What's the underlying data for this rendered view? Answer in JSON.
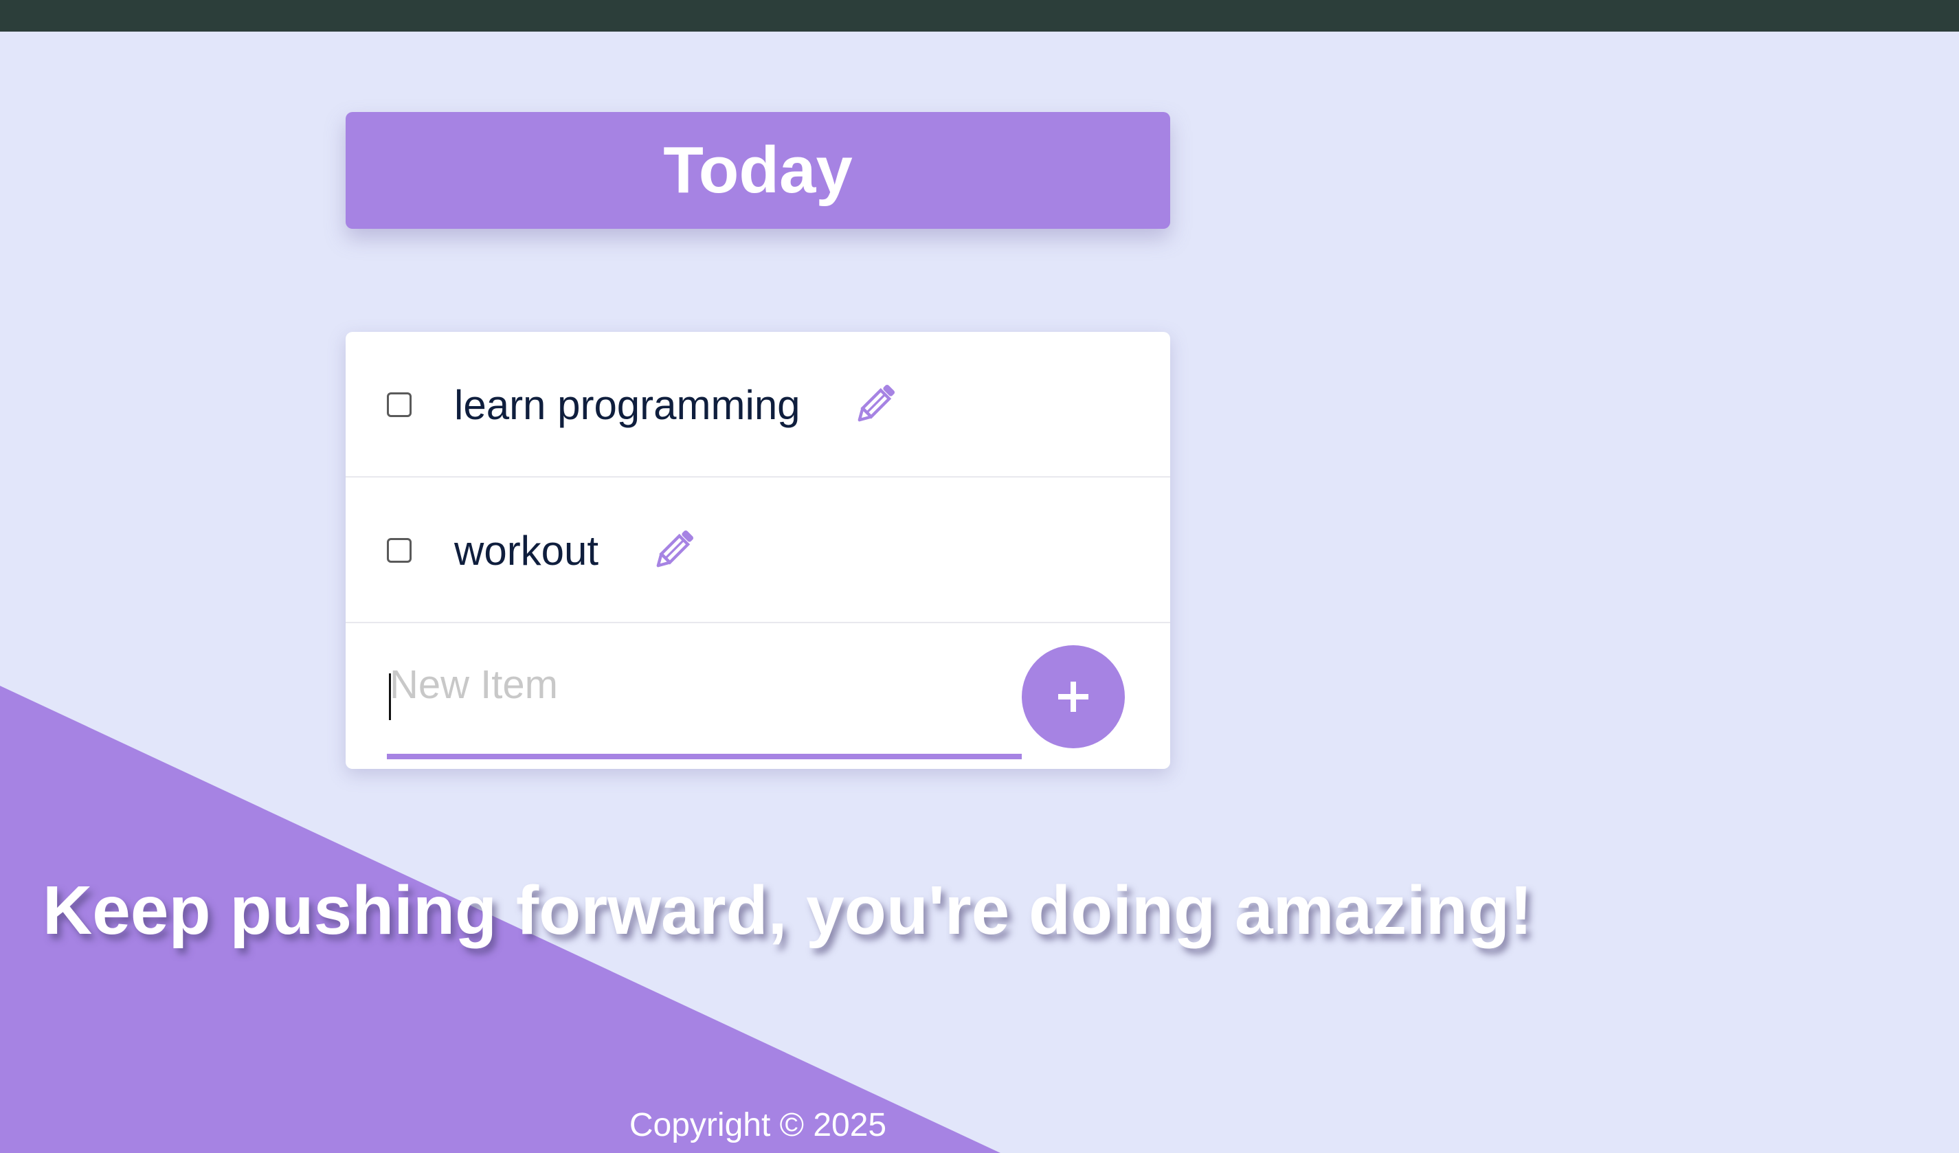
{
  "app": {
    "heading": "Today"
  },
  "todos": [
    {
      "text": "learn programming",
      "checked": false
    },
    {
      "text": "workout",
      "checked": false
    }
  ],
  "new_item": {
    "placeholder": "New Item",
    "value": "",
    "add_label": "+"
  },
  "motivation": "Keep pushing forward, you're doing amazing!",
  "footer": {
    "copyright": "Copyright © 2025"
  },
  "icons": {
    "edit": "pencil-icon",
    "add": "plus-icon"
  },
  "colors": {
    "accent": "#A683E3",
    "background": "#E2E6FA",
    "text": "#0F1E3D",
    "top_bar": "#2C3E3A"
  }
}
